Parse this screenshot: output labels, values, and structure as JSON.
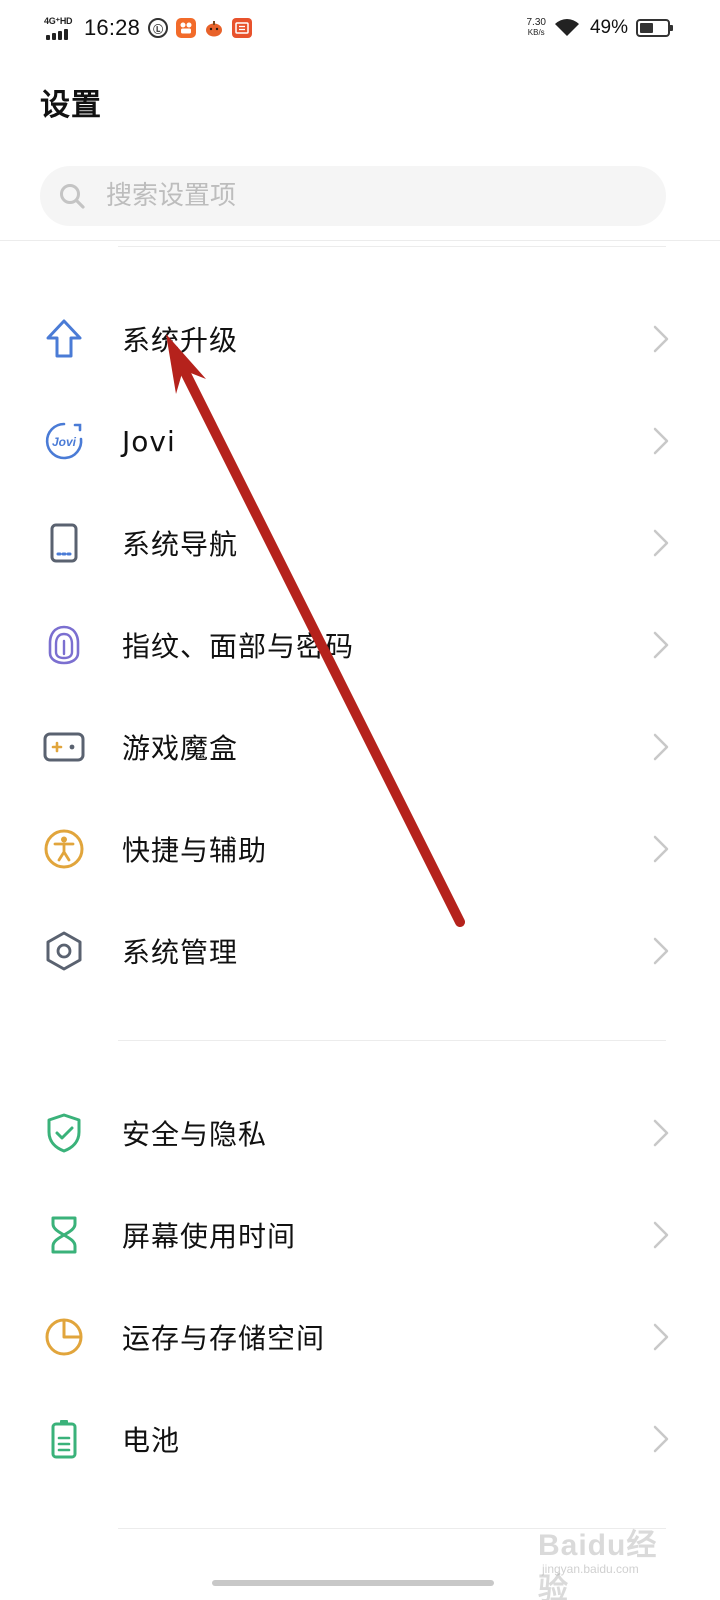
{
  "status_bar": {
    "network": "4G⁺HD",
    "time": "16:28",
    "speed_value": "7.30",
    "speed_unit": "KB/s",
    "battery_percent": "49%",
    "battery_level": 0.49
  },
  "header": {
    "title": "设置"
  },
  "search": {
    "placeholder": "搜索设置项"
  },
  "groups": [
    {
      "items": [
        {
          "label": "系统升级",
          "icon": "arrow-up-icon",
          "color": "#4a7bd6"
        },
        {
          "label": "Jovi",
          "icon": "jovi-icon",
          "color": "#4a7bd6"
        },
        {
          "label": "系统导航",
          "icon": "phone-navigation-icon",
          "color": "#5a6270"
        },
        {
          "label": "指纹、面部与密码",
          "icon": "fingerprint-icon",
          "color": "#7b6fd0"
        },
        {
          "label": "游戏魔盒",
          "icon": "gamepad-icon",
          "color": "#5a6270"
        },
        {
          "label": "快捷与辅助",
          "icon": "accessibility-icon",
          "color": "#e1a53c"
        },
        {
          "label": "系统管理",
          "icon": "hexagon-settings-icon",
          "color": "#5a6270"
        }
      ]
    },
    {
      "items": [
        {
          "label": "安全与隐私",
          "icon": "shield-check-icon",
          "color": "#3ab27a"
        },
        {
          "label": "屏幕使用时间",
          "icon": "hourglass-icon",
          "color": "#3ab27a"
        },
        {
          "label": "运存与存储空间",
          "icon": "pie-chart-icon",
          "color": "#e1a53c"
        },
        {
          "label": "电池",
          "icon": "battery-icon",
          "color": "#3ab27a"
        }
      ]
    }
  ],
  "annotation_color": "#b5221c",
  "watermark": {
    "text": "Baidu经验",
    "sub": "jingyan.baidu.com"
  }
}
